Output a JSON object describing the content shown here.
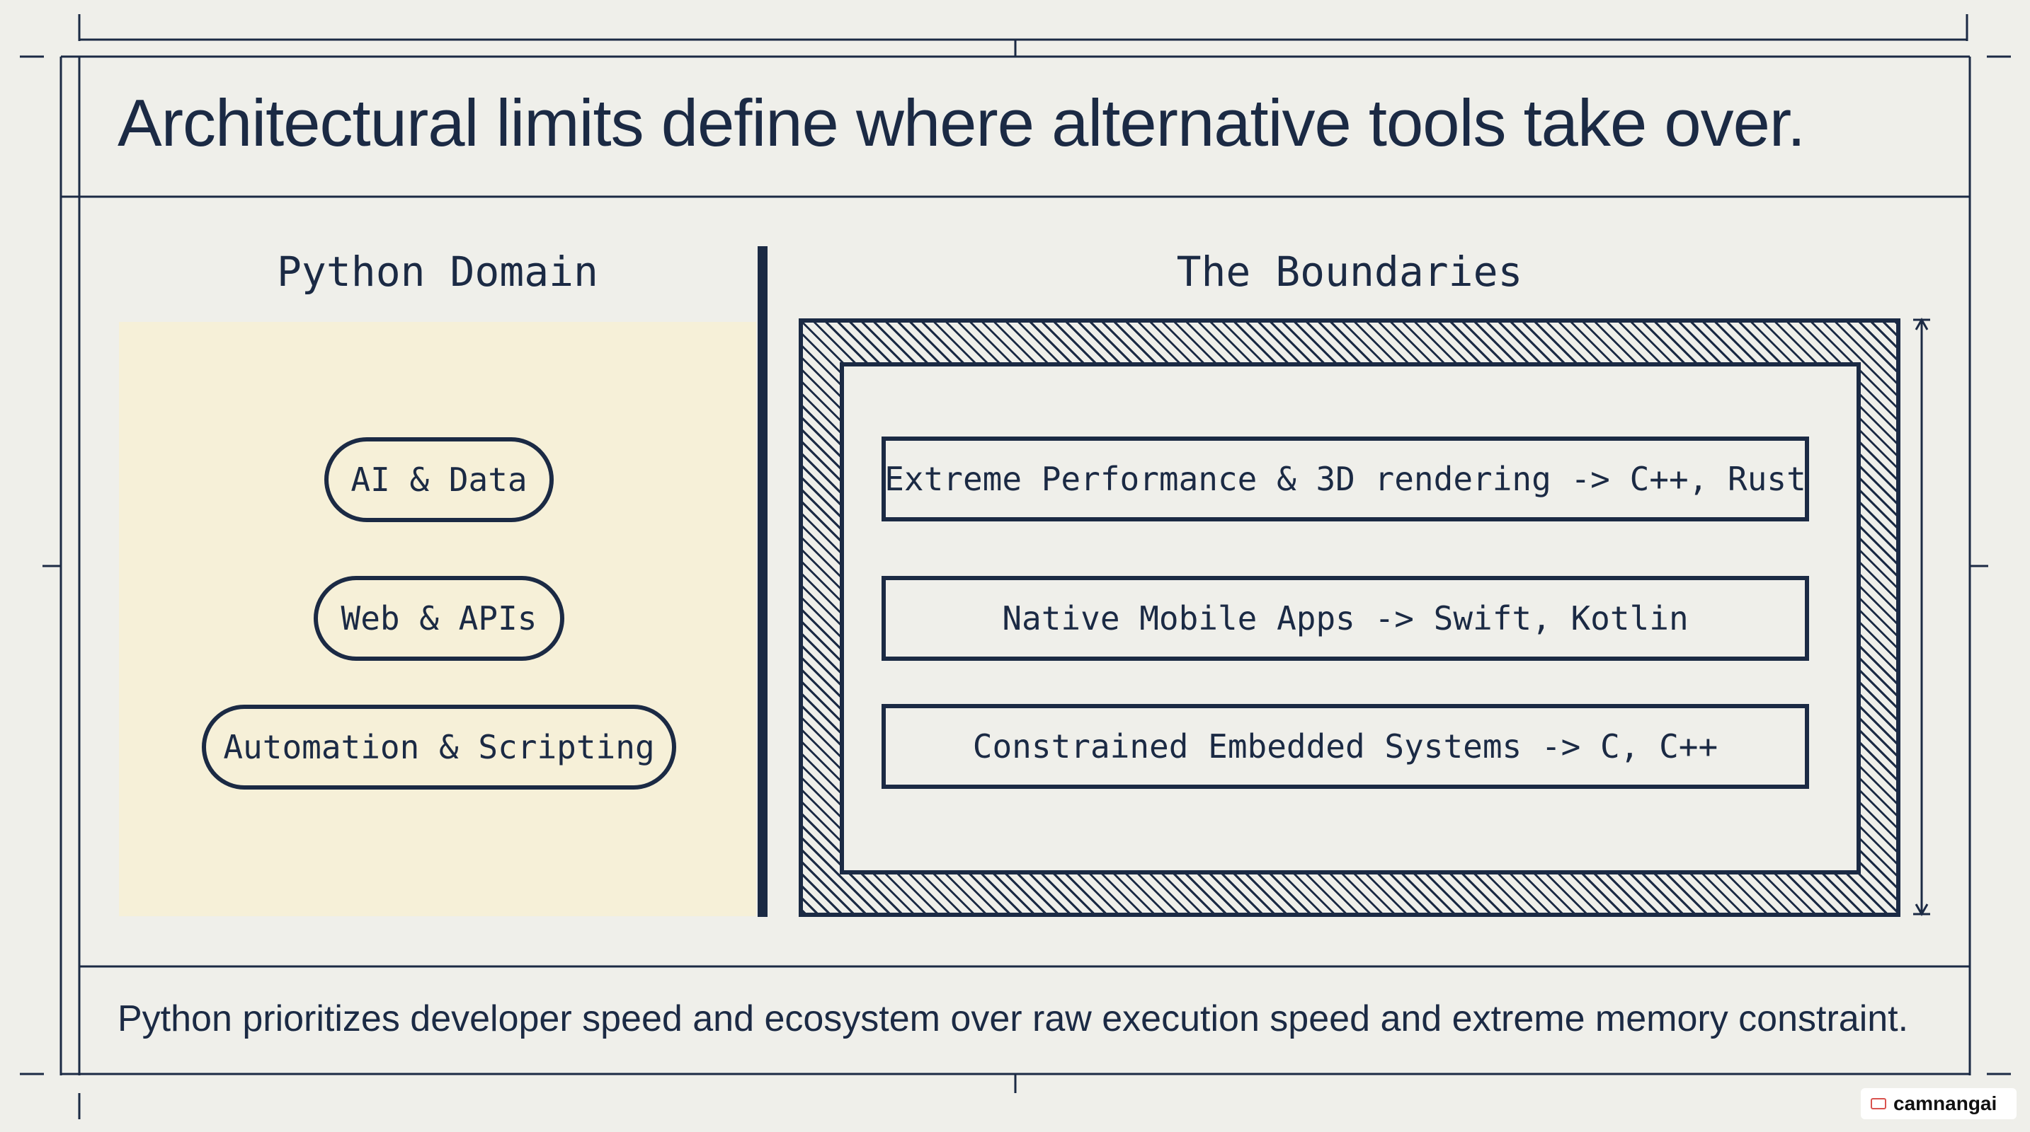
{
  "title": "Architectural limits define where alternative tools take over.",
  "left": {
    "heading": "Python Domain",
    "items": [
      "AI & Data",
      "Web & APIs",
      "Automation & Scripting"
    ]
  },
  "right": {
    "heading": "The Boundaries",
    "items": [
      "Extreme Performance & 3D rendering -> C++, Rust",
      "Native Mobile Apps -> Swift, Kotlin",
      "Constrained Embedded Systems -> C, C++"
    ]
  },
  "caption": "Python prioritizes developer speed and ecosystem over raw execution speed and extreme memory constraint.",
  "watermark": "camnangai",
  "colors": {
    "ink": "#1b2a44",
    "background": "#efefea",
    "panel": "#f6f0d8"
  }
}
